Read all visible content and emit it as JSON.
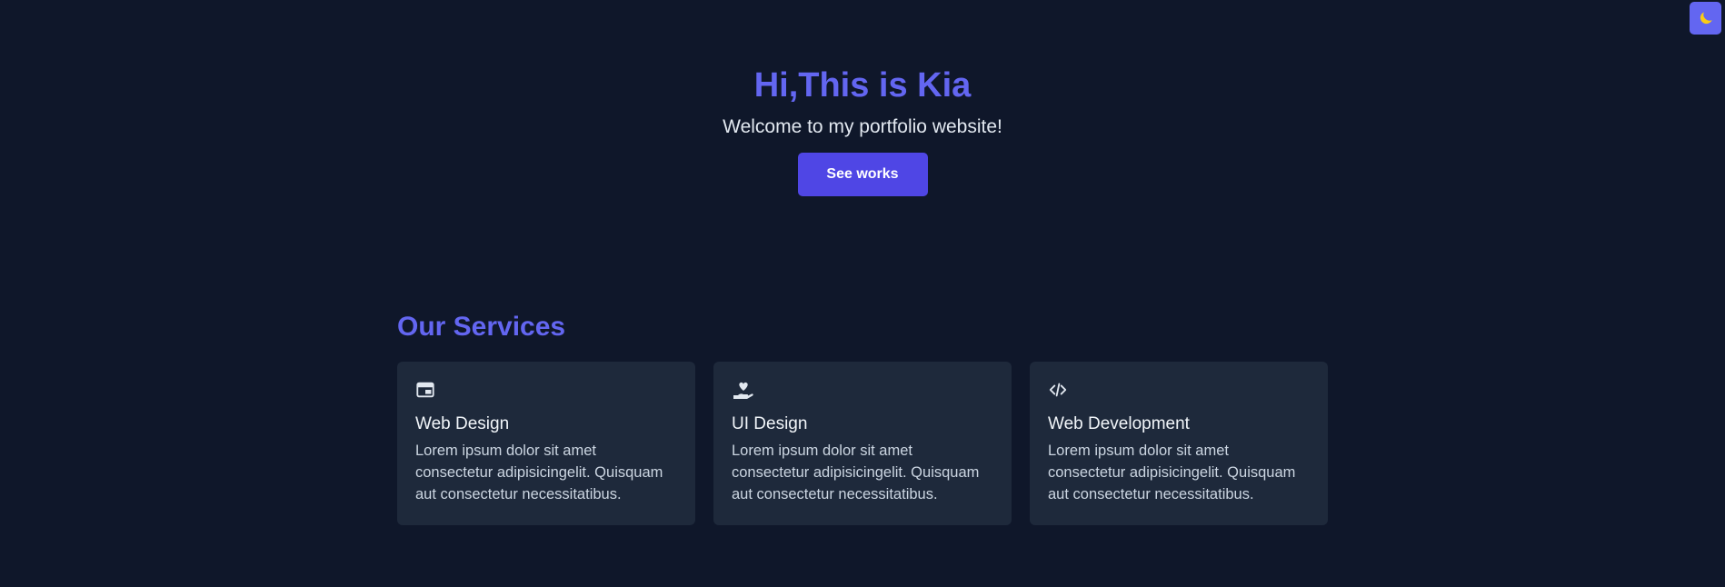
{
  "theme_toggle": {
    "icon": "moon-icon"
  },
  "hero": {
    "title": "Hi,This is Kia",
    "subtitle": "Welcome to my portfolio website!",
    "button_label": "See works"
  },
  "services": {
    "title": "Our Services",
    "cards": [
      {
        "icon": "browser-window-icon",
        "title": "Web Design",
        "text": "Lorem ipsum dolor sit amet consectetur adipisicingelit. Quisquam aut consectetur necessitatibus."
      },
      {
        "icon": "hand-heart-icon",
        "title": "UI Design",
        "text": "Lorem ipsum dolor sit amet consectetur adipisicingelit. Quisquam aut consectetur necessitatibus."
      },
      {
        "icon": "code-icon",
        "title": "Web Development",
        "text": "Lorem ipsum dolor sit amet consectetur adipisicingelit. Quisquam aut consectetur necessitatibus."
      }
    ]
  },
  "colors": {
    "background": "#0f172a",
    "accent": "#6366f1",
    "button": "#4f46e5",
    "card": "#1e293b"
  }
}
